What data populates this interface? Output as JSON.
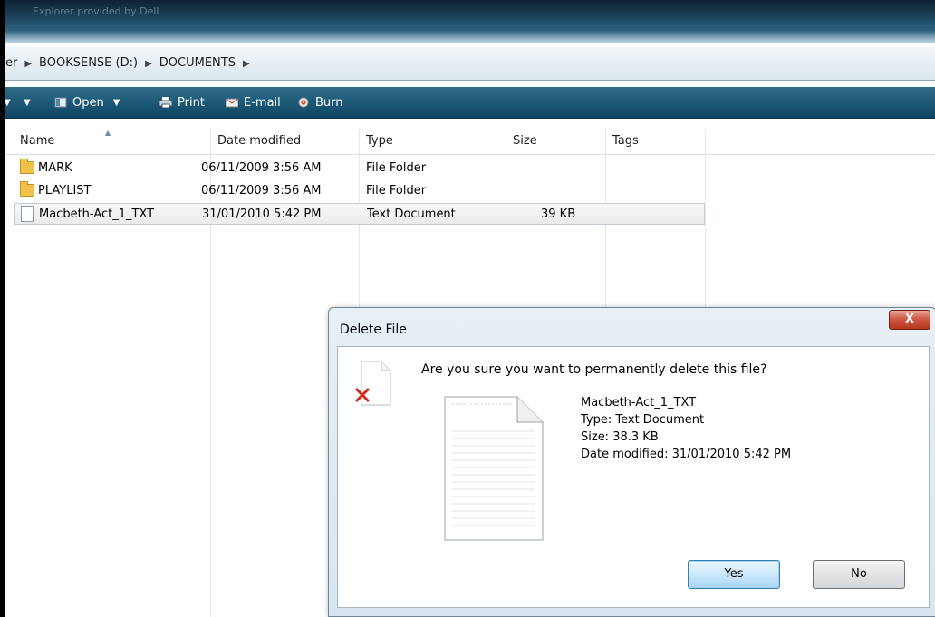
{
  "window": {
    "title": "Explorer provided by Dell"
  },
  "address": {
    "prefix": "er",
    "segments": [
      "BOOKSENSE (D:)",
      "DOCUMENTS"
    ]
  },
  "toolbar": {
    "open": "Open",
    "print": "Print",
    "email": "E-mail",
    "burn": "Burn"
  },
  "columns": {
    "name": "Name",
    "date": "Date modified",
    "type": "Type",
    "size": "Size",
    "tags": "Tags"
  },
  "files": [
    {
      "name": "MARK",
      "date": "06/11/2009 3:56 AM",
      "type": "File Folder",
      "size": "",
      "icon": "folder-icon"
    },
    {
      "name": "PLAYLIST",
      "date": "06/11/2009 3:56 AM",
      "type": "File Folder",
      "size": "",
      "icon": "folder-icon"
    },
    {
      "name": "Macbeth-Act_1_TXT",
      "date": "31/01/2010 5:42 PM",
      "type": "Text Document",
      "size": "39 KB",
      "icon": "text-document-icon",
      "selected": true
    }
  ],
  "dialog": {
    "title": "Delete File",
    "close": "X",
    "question": "Are you sure you want to permanently delete this file?",
    "file_name": "Macbeth-Act_1_TXT",
    "file_type": "Type: Text Document",
    "file_size": "Size: 38.3 KB",
    "file_date": "Date modified: 31/01/2010 5:42 PM",
    "yes": "Yes",
    "no": "No"
  },
  "colors": {
    "toolbar": "#1d5a78",
    "titlebar": "#1f4a63",
    "close_button": "#cf5a45",
    "folder": "#f0c24a"
  }
}
